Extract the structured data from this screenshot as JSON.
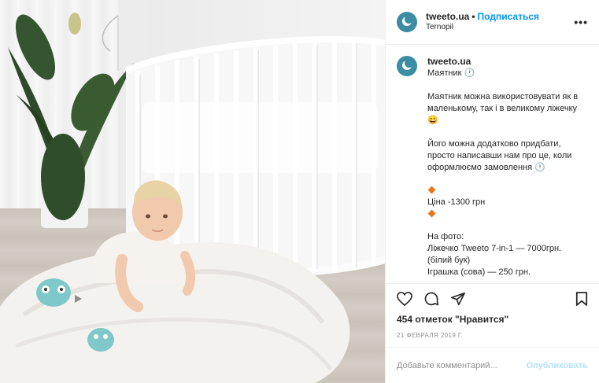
{
  "post": {
    "username": "tweeto.ua",
    "separator": "•",
    "follow_label": "Подписаться",
    "location": "Ternopil",
    "more_label": "•••"
  },
  "caption": {
    "username": "tweeto.ua",
    "title": "Маятник 🕐",
    "paragraph1": "Маятник можна використовувати як в маленькому, так і в великому ліжечку 😀",
    "paragraph2": "Його можна додатково придбати, просто написавши нам про це, коли оформлюємо замовлення 🕐",
    "price": "Ціна -1300 грн",
    "photo_heading": "На фото:",
    "item1": "Ліжечко Tweeto 7-in-1 — 7000грн. (білий бук)",
    "item2": "Іграшка (сова) — 250 грн."
  },
  "actions": {
    "icons": [
      "heart-icon",
      "comment-icon",
      "share-icon",
      "bookmark-icon"
    ]
  },
  "likes_label": "454 отметок \"Нравится\"",
  "date_label": "21 ФЕВРАЛЯ 2019 Г.",
  "comment_box": {
    "placeholder": "Добавьте комментарий...",
    "publish_label": "Опубликовать"
  },
  "colors": {
    "accent_blue": "#0095f6",
    "publish_disabled": "#b2dffc",
    "avatar": "#3a8da3",
    "diamond": "#e87722"
  }
}
